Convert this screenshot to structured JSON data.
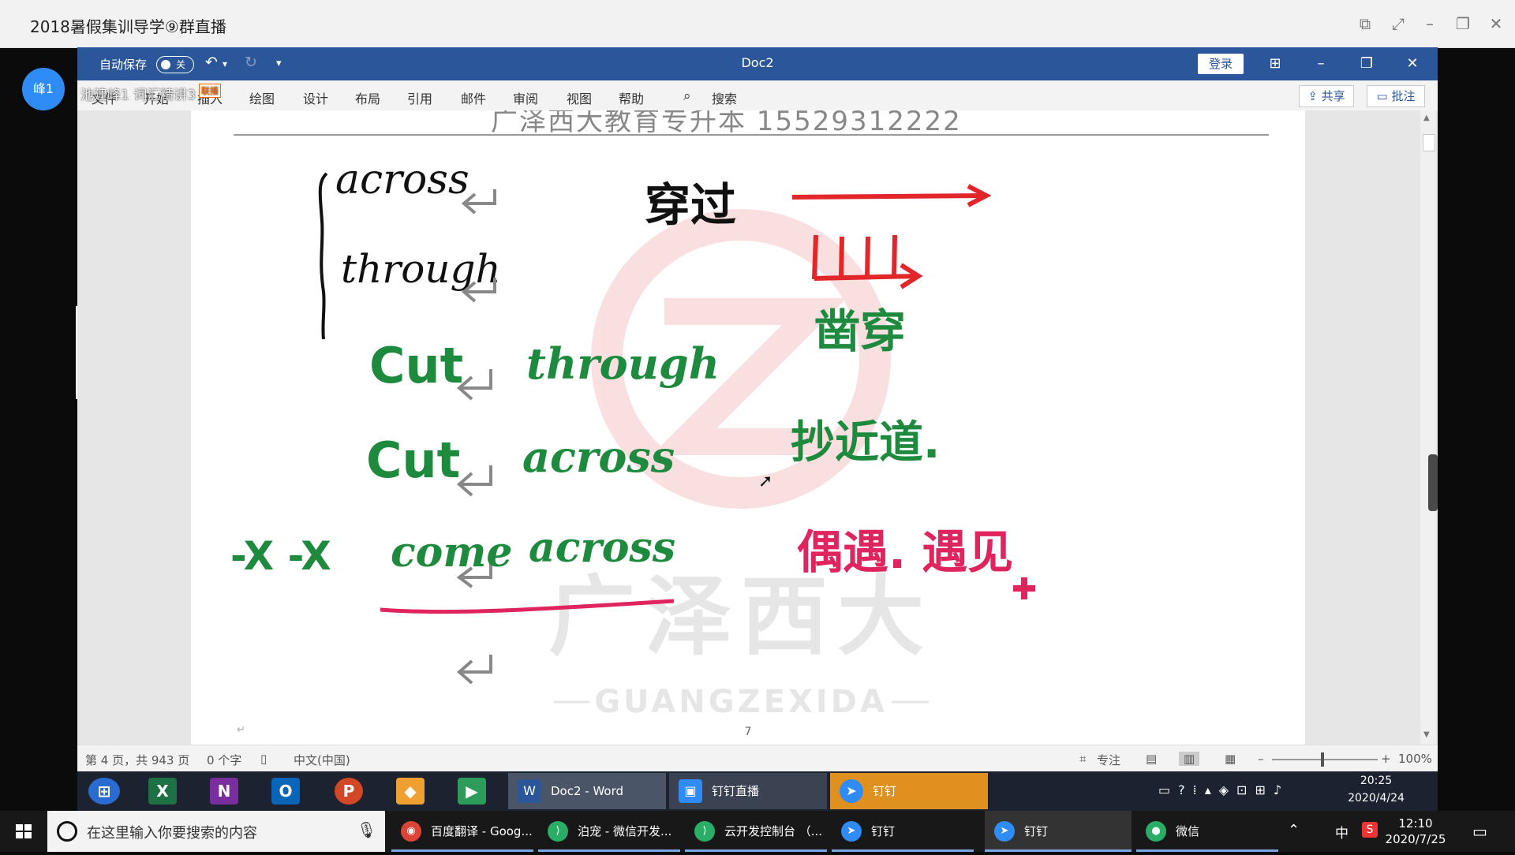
{
  "outer_window": {
    "title": "2018暑假集训导学⑨群直播",
    "avatar_label": "峰1"
  },
  "stream_overlay": {
    "text": "池建峰1 词汇精讲3",
    "badge": "联播"
  },
  "word": {
    "autosave_label": "自动保存",
    "autosave_state": "关",
    "doc_title": "Doc2",
    "login_label": "登录",
    "tabs": [
      "文件",
      "开始",
      "插入",
      "绘图",
      "设计",
      "布局",
      "引用",
      "邮件",
      "审阅",
      "视图",
      "帮助"
    ],
    "search_label": "搜索",
    "share_label": "共享",
    "comment_label": "批注",
    "header_text": "广泽西大教育专升本 15529312222",
    "page_number": "7",
    "page_mark": "↵",
    "watermark_chinese": "广泽西大",
    "watermark_english": "GUANGZEXIDA",
    "status": {
      "page_info": "第 4 页，共 943 页",
      "word_count": "0 个字",
      "language": "中文(中国)",
      "focus": "专注",
      "zoom": "100%"
    }
  },
  "handwriting": {
    "across": "across",
    "through": "through",
    "meaning_pass": "穿过",
    "cut1": "Cut",
    "through2": "through",
    "meaning_cut_through": "凿穿",
    "cut2": "Cut",
    "across2": "across",
    "meaning_cut_across": "抄近道.",
    "strike": "-X -X",
    "come": "come",
    "across3": "across",
    "meaning_come_across": "偶遇. 遇见",
    "return_mark": "↵"
  },
  "shared_taskbar": {
    "tasks": [
      "Doc2 - Word",
      "钉钉直播",
      "钉钉"
    ],
    "time": "20:25",
    "date": "2020/4/24"
  },
  "win_taskbar": {
    "search_placeholder": "在这里输入你要搜索的内容",
    "tasks": [
      "百度翻译 - Goog...",
      "泊宠 - 微信开发...",
      "云开发控制台 （...",
      "钉钉",
      "钉钉",
      "微信"
    ],
    "ime": "中",
    "time": "12:10",
    "date": "2020/7/25"
  },
  "colors": {
    "word_blue": "#2b579a",
    "ink_green": "#1e8a3e",
    "ink_red": "#e2262a",
    "ink_pink": "#e0245e",
    "accent_blue": "#2f8cf7"
  }
}
